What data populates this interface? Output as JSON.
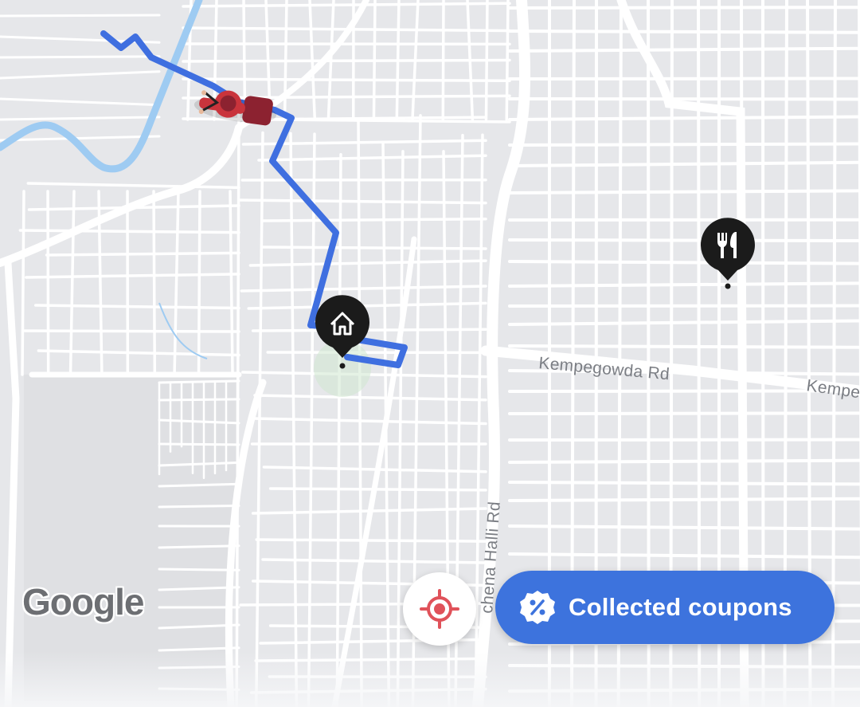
{
  "map": {
    "road_labels": {
      "kempegowda_rd": "Kempegowda Rd",
      "kempegowda_rd_partial": "Kempe",
      "chena_halli_rd": "chena Halli Rd"
    },
    "attribution": "Google"
  },
  "markers": {
    "home_icon": "home-icon",
    "restaurant_icon": "fork-knife-icon",
    "rider_icon": "delivery-scooter-icon"
  },
  "actions": {
    "locate_icon": "crosshair-target-icon",
    "coupons_label": "Collected coupons",
    "coupons_icon": "percent-badge-icon"
  },
  "colors": {
    "route": "#3f6fe0",
    "coupon_button": "#3d73dd",
    "locate_icon": "#e0525a",
    "marker": "#1b1b1b",
    "water": "#9ecbf2"
  }
}
